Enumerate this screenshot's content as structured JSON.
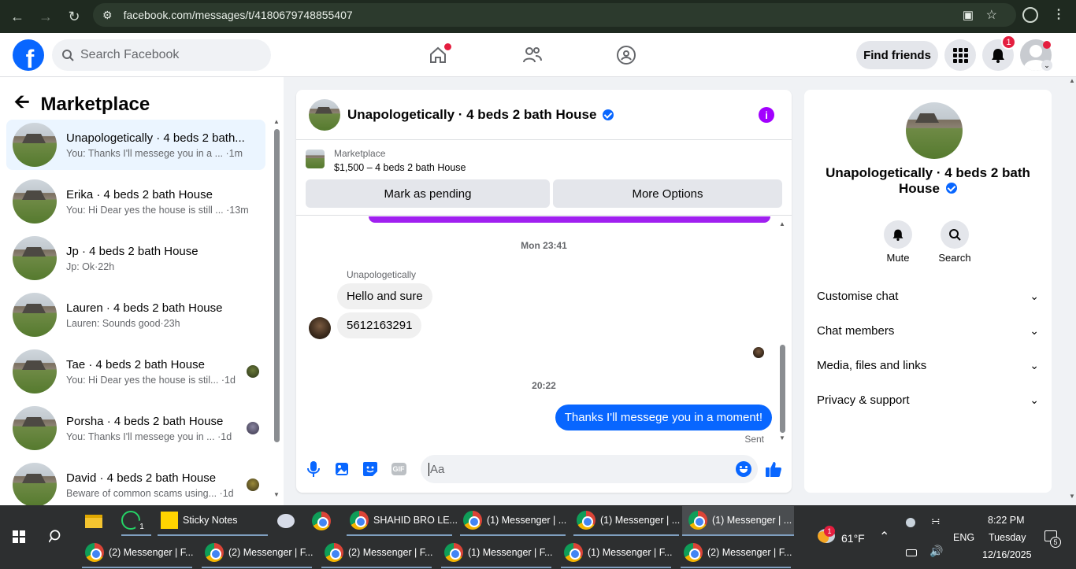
{
  "browser": {
    "url": "facebook.com/messages/t/4180679748855407"
  },
  "fb_header": {
    "search_placeholder": "Search Facebook",
    "find_friends": "Find friends",
    "notif_count": "1"
  },
  "sidebar": {
    "title": "Marketplace",
    "conversations": [
      {
        "name": "Unapologetically · 4 beds 2 bath...",
        "preview": "You: Thanks I'll messege you in a ...",
        "time": "·1m"
      },
      {
        "name": "Erika · 4 beds 2 bath House",
        "preview": "You: Hi Dear yes the house is still ...",
        "time": "·13m"
      },
      {
        "name": "Jp · 4 beds 2 bath House",
        "preview": "Jp: Ok",
        "time": "·22h"
      },
      {
        "name": "Lauren · 4 beds 2 bath House",
        "preview": "Lauren: Sounds good",
        "time": "·23h"
      },
      {
        "name": "Tae · 4 beds 2 bath House",
        "preview": "You: Hi Dear yes the house is stil...",
        "time": "·1d"
      },
      {
        "name": "Porsha · 4 beds 2 bath House",
        "preview": "You: Thanks I'll messege you in ...",
        "time": "·1d"
      },
      {
        "name": "David · 4 beds 2 bath House",
        "preview": "Beware of common scams using...",
        "time": "·1d"
      }
    ]
  },
  "chat": {
    "title": "Unapologetically · 4 beds 2 bath House",
    "marketplace_label": "Marketplace",
    "listing": "$1,500 – 4 beds 2 bath House",
    "mark_pending": "Mark as pending",
    "more_options": "More Options",
    "ts1": "Mon 23:41",
    "sender": "Unapologetically",
    "msg1": "Hello and sure",
    "msg2": "5612163291",
    "ts2": "20:22",
    "msg_out": "Thanks I'll messege you in a moment!",
    "sent_status": "Sent",
    "composer_placeholder": "Aa",
    "gif_label": "GIF"
  },
  "details": {
    "name": "Unapologetically · 4 beds 2 bath House",
    "mute": "Mute",
    "search": "Search",
    "rows": [
      "Customise chat",
      "Chat members",
      "Media, files and links",
      "Privacy & support"
    ]
  },
  "taskbar": {
    "sticky_notes": "Sticky Notes",
    "shahid": "SHAHID BRO LE...",
    "row1": [
      "(1) Messenger | ...",
      "(1) Messenger | ...",
      "(1) Messenger | ..."
    ],
    "row2": [
      "(2) Messenger | F...",
      "(2) Messenger | F...",
      "(2) Messenger | F...",
      "(1) Messenger | F...",
      "(1) Messenger | F...",
      "(2) Messenger | F..."
    ],
    "whatsapp_count": "1",
    "weather_badge": "1",
    "temp": "61°F",
    "lang": "ENG",
    "time": "8:22 PM",
    "day": "Tuesday",
    "date": "12/16/2025",
    "notif": "5"
  },
  "colors": {
    "fb_blue": "#0866ff",
    "accent_purple": "#a020f0",
    "red_badge": "#e41e3f"
  }
}
